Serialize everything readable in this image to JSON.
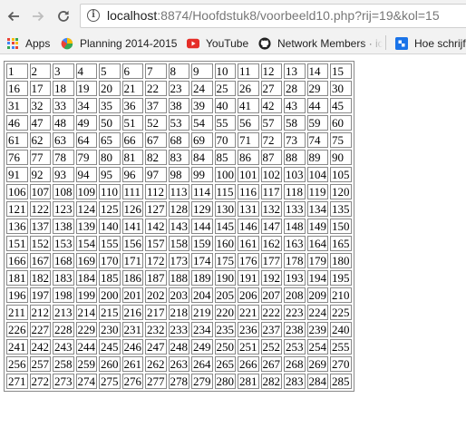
{
  "browser": {
    "url_host": "localhost",
    "url_rest": ":8874/Hoofdstuk8/voorbeeld10.php?rij=19&kol=15",
    "icons": [
      "back-arrow-icon",
      "forward-arrow-icon",
      "reload-icon",
      "site-info-icon"
    ]
  },
  "bookmarks": {
    "items": [
      {
        "label": "Apps",
        "icon": "apps-grid-icon"
      },
      {
        "label": "Planning 2014-2015",
        "icon": "google-drive-icon"
      },
      {
        "label": "YouTube",
        "icon": "youtube-icon"
      },
      {
        "label": "Network Members · ic",
        "icon": "github-icon"
      },
      {
        "label": "Hoe schrijf",
        "icon": "bookmark-site-icon"
      }
    ]
  },
  "colors": {
    "toolbar_bg": "#f2f2f2",
    "youtube_red": "#e52d27",
    "bookmark_blue": "#1a73e8"
  },
  "table": {
    "rows": 19,
    "cols": 15,
    "cells": [
      [
        "1",
        "2",
        "3",
        "4",
        "5",
        "6",
        "7",
        "8",
        "9",
        "10",
        "11",
        "12",
        "13",
        "14",
        "15"
      ],
      [
        "16",
        "17",
        "18",
        "19",
        "20",
        "21",
        "22",
        "23",
        "24",
        "25",
        "26",
        "27",
        "28",
        "29",
        "30"
      ],
      [
        "31",
        "32",
        "33",
        "34",
        "35",
        "36",
        "37",
        "38",
        "39",
        "40",
        "41",
        "42",
        "43",
        "44",
        "45"
      ],
      [
        "46",
        "47",
        "48",
        "49",
        "50",
        "51",
        "52",
        "53",
        "54",
        "55",
        "56",
        "57",
        "58",
        "59",
        "60"
      ],
      [
        "61",
        "62",
        "63",
        "64",
        "65",
        "66",
        "67",
        "68",
        "69",
        "70",
        "71",
        "72",
        "73",
        "74",
        "75"
      ],
      [
        "76",
        "77",
        "78",
        "79",
        "80",
        "81",
        "82",
        "83",
        "84",
        "85",
        "86",
        "87",
        "88",
        "89",
        "90"
      ],
      [
        "91",
        "92",
        "93",
        "94",
        "95",
        "96",
        "97",
        "98",
        "99",
        "100",
        "101",
        "102",
        "103",
        "104",
        "105"
      ],
      [
        "106",
        "107",
        "108",
        "109",
        "110",
        "111",
        "112",
        "113",
        "114",
        "115",
        "116",
        "117",
        "118",
        "119",
        "120"
      ],
      [
        "121",
        "122",
        "123",
        "124",
        "125",
        "126",
        "127",
        "128",
        "129",
        "130",
        "131",
        "132",
        "133",
        "134",
        "135"
      ],
      [
        "136",
        "137",
        "138",
        "139",
        "140",
        "141",
        "142",
        "143",
        "144",
        "145",
        "146",
        "147",
        "148",
        "149",
        "150"
      ],
      [
        "151",
        "152",
        "153",
        "154",
        "155",
        "156",
        "157",
        "158",
        "159",
        "160",
        "161",
        "162",
        "163",
        "164",
        "165"
      ],
      [
        "166",
        "167",
        "168",
        "169",
        "170",
        "171",
        "172",
        "173",
        "174",
        "175",
        "176",
        "177",
        "178",
        "179",
        "180"
      ],
      [
        "181",
        "182",
        "183",
        "184",
        "185",
        "186",
        "187",
        "188",
        "189",
        "190",
        "191",
        "192",
        "193",
        "194",
        "195"
      ],
      [
        "196",
        "197",
        "198",
        "199",
        "200",
        "201",
        "202",
        "203",
        "204",
        "205",
        "206",
        "207",
        "208",
        "209",
        "210"
      ],
      [
        "211",
        "212",
        "213",
        "214",
        "215",
        "216",
        "217",
        "218",
        "219",
        "220",
        "221",
        "222",
        "223",
        "224",
        "225"
      ],
      [
        "226",
        "227",
        "228",
        "229",
        "230",
        "231",
        "232",
        "233",
        "234",
        "235",
        "236",
        "237",
        "238",
        "239",
        "240"
      ],
      [
        "241",
        "242",
        "243",
        "244",
        "245",
        "246",
        "247",
        "248",
        "249",
        "250",
        "251",
        "252",
        "253",
        "254",
        "255"
      ],
      [
        "256",
        "257",
        "258",
        "259",
        "260",
        "261",
        "262",
        "263",
        "264",
        "265",
        "266",
        "267",
        "268",
        "269",
        "270"
      ],
      [
        "271",
        "272",
        "273",
        "274",
        "275",
        "276",
        "277",
        "278",
        "279",
        "280",
        "281",
        "282",
        "283",
        "284",
        "285"
      ]
    ]
  }
}
